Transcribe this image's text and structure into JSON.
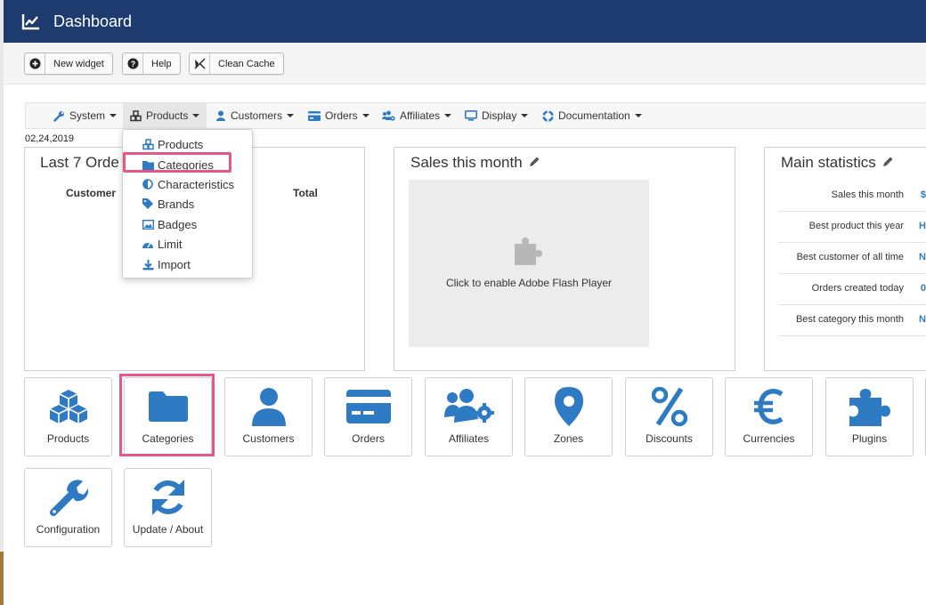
{
  "header": {
    "title": "Dashboard",
    "icon": "line-chart-icon"
  },
  "toolbar": {
    "new_widget": "New widget",
    "help": "Help",
    "clean_cache": "Clean Cache"
  },
  "menu": {
    "items": [
      {
        "label": "System",
        "icon": "wrench-icon"
      },
      {
        "label": "Products",
        "icon": "cubes-icon"
      },
      {
        "label": "Customers",
        "icon": "user-icon"
      },
      {
        "label": "Orders",
        "icon": "credit-card-icon"
      },
      {
        "label": "Affiliates",
        "icon": "users-gear-icon"
      },
      {
        "label": "Display",
        "icon": "monitor-icon"
      },
      {
        "label": "Documentation",
        "icon": "lifebuoy-icon"
      }
    ],
    "active": "Products"
  },
  "dropdown": {
    "items": [
      {
        "label": "Products",
        "icon": "cubes-icon"
      },
      {
        "label": "Categories",
        "icon": "folder-icon"
      },
      {
        "label": "Characteristics",
        "icon": "half-circle-icon"
      },
      {
        "label": "Brands",
        "icon": "tag-icon"
      },
      {
        "label": "Badges",
        "icon": "image-icon"
      },
      {
        "label": "Limit",
        "icon": "gauge-icon"
      },
      {
        "label": "Import",
        "icon": "download-icon"
      }
    ],
    "highlighted": "Categories"
  },
  "date": "02,24,2019",
  "panels": {
    "orders": {
      "title": "Last 7 Orde",
      "col_customer": "Customer",
      "col_total": "Total"
    },
    "sales": {
      "title": "Sales this month",
      "flash_text": "Click to enable Adobe Flash Player"
    },
    "stats": {
      "title": "Main statistics",
      "rows": [
        {
          "label": "Sales this month",
          "value": "$"
        },
        {
          "label": "Best product this year",
          "value": "H"
        },
        {
          "label": "Best customer of all time",
          "value": "N"
        },
        {
          "label": "Orders created today",
          "value": "0"
        },
        {
          "label": "Best category this month",
          "value": "N"
        }
      ]
    }
  },
  "tiles": [
    {
      "label": "Products",
      "icon": "cubes-icon"
    },
    {
      "label": "Categories",
      "icon": "folder-icon"
    },
    {
      "label": "Customers",
      "icon": "user-icon"
    },
    {
      "label": "Orders",
      "icon": "credit-card-icon"
    },
    {
      "label": "Affiliates",
      "icon": "users-gear-icon"
    },
    {
      "label": "Zones",
      "icon": "map-marker-icon"
    },
    {
      "label": "Discounts",
      "icon": "percent-icon"
    },
    {
      "label": "Currencies",
      "icon": "euro-icon"
    },
    {
      "label": "Plugins",
      "icon": "puzzle-icon"
    },
    {
      "label": "Configuration",
      "icon": "wrench-icon"
    },
    {
      "label": "Update / About",
      "icon": "refresh-icon"
    }
  ],
  "colors": {
    "header": "#1d3b6e",
    "accent": "#2e7bc4",
    "highlight": "#e8578b"
  }
}
